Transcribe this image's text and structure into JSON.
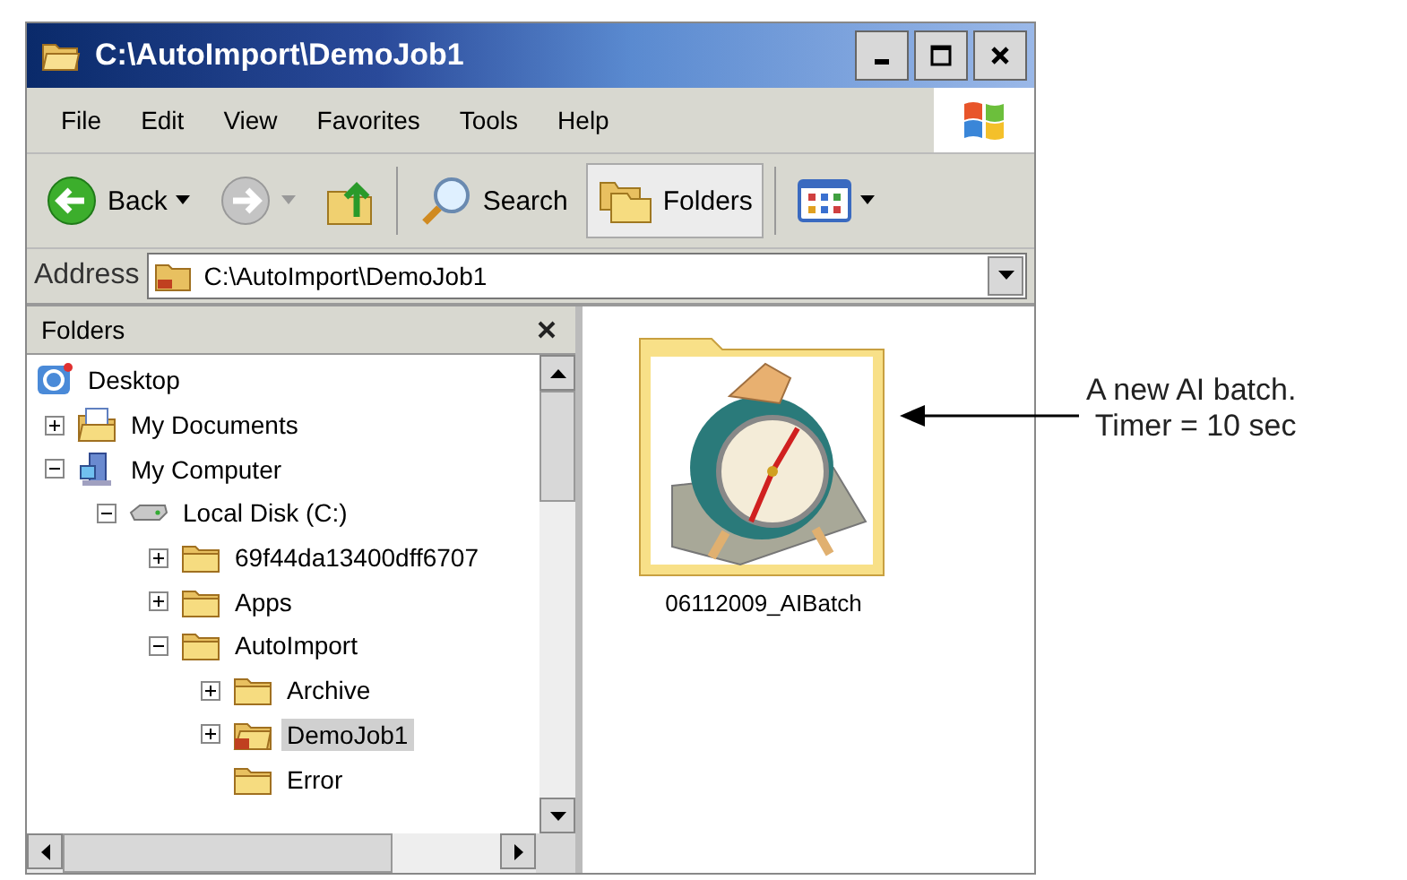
{
  "window": {
    "title": "C:\\AutoImport\\DemoJob1"
  },
  "menu": [
    "File",
    "Edit",
    "View",
    "Favorites",
    "Tools",
    "Help"
  ],
  "toolbar": [
    {
      "kind": "back",
      "label": "Back",
      "disabled": false
    },
    {
      "kind": "forward",
      "disabled": true
    },
    {
      "kind": "up"
    },
    {
      "kind": "search",
      "label": "Search",
      "selected": false
    },
    {
      "kind": "folders",
      "label": "Folders",
      "selected": true
    },
    {
      "kind": "views"
    }
  ],
  "address": {
    "label": "Address",
    "value": "C:\\AutoImport\\DemoJob1"
  },
  "folders_pane": {
    "title": "Folders",
    "tree": [
      {
        "label": "Desktop",
        "kind": "desktop",
        "selected": false,
        "children": [
          {
            "label": "My Documents",
            "kind": "documents",
            "expanded": false,
            "selected": false
          },
          {
            "label": "My Computer",
            "kind": "computer",
            "expanded": true,
            "selected": false,
            "children": [
              {
                "label": "Local Disk (C:)",
                "kind": "disk",
                "expanded": true,
                "selected": false,
                "children": [
                  {
                    "label": "69f44da13400dff6707",
                    "kind": "folder",
                    "expanded": false,
                    "selected": false
                  },
                  {
                    "label": "Apps",
                    "kind": "folder",
                    "expanded": false,
                    "selected": false
                  },
                  {
                    "label": "AutoImport",
                    "kind": "folder",
                    "expanded": true,
                    "selected": false,
                    "children": [
                      {
                        "label": "Archive",
                        "kind": "folder",
                        "expanded": false,
                        "selected": false
                      },
                      {
                        "label": "DemoJob1",
                        "kind": "job-folder",
                        "expanded": false,
                        "selected": true
                      },
                      {
                        "label": "Error",
                        "kind": "folder",
                        "selected": false
                      }
                    ]
                  }
                ]
              }
            ]
          }
        ]
      }
    ]
  },
  "files": [
    {
      "name": "06112009_AIBatch"
    }
  ],
  "annotation": {
    "lines": [
      "A new AI batch.",
      "Timer = 10 sec"
    ]
  }
}
